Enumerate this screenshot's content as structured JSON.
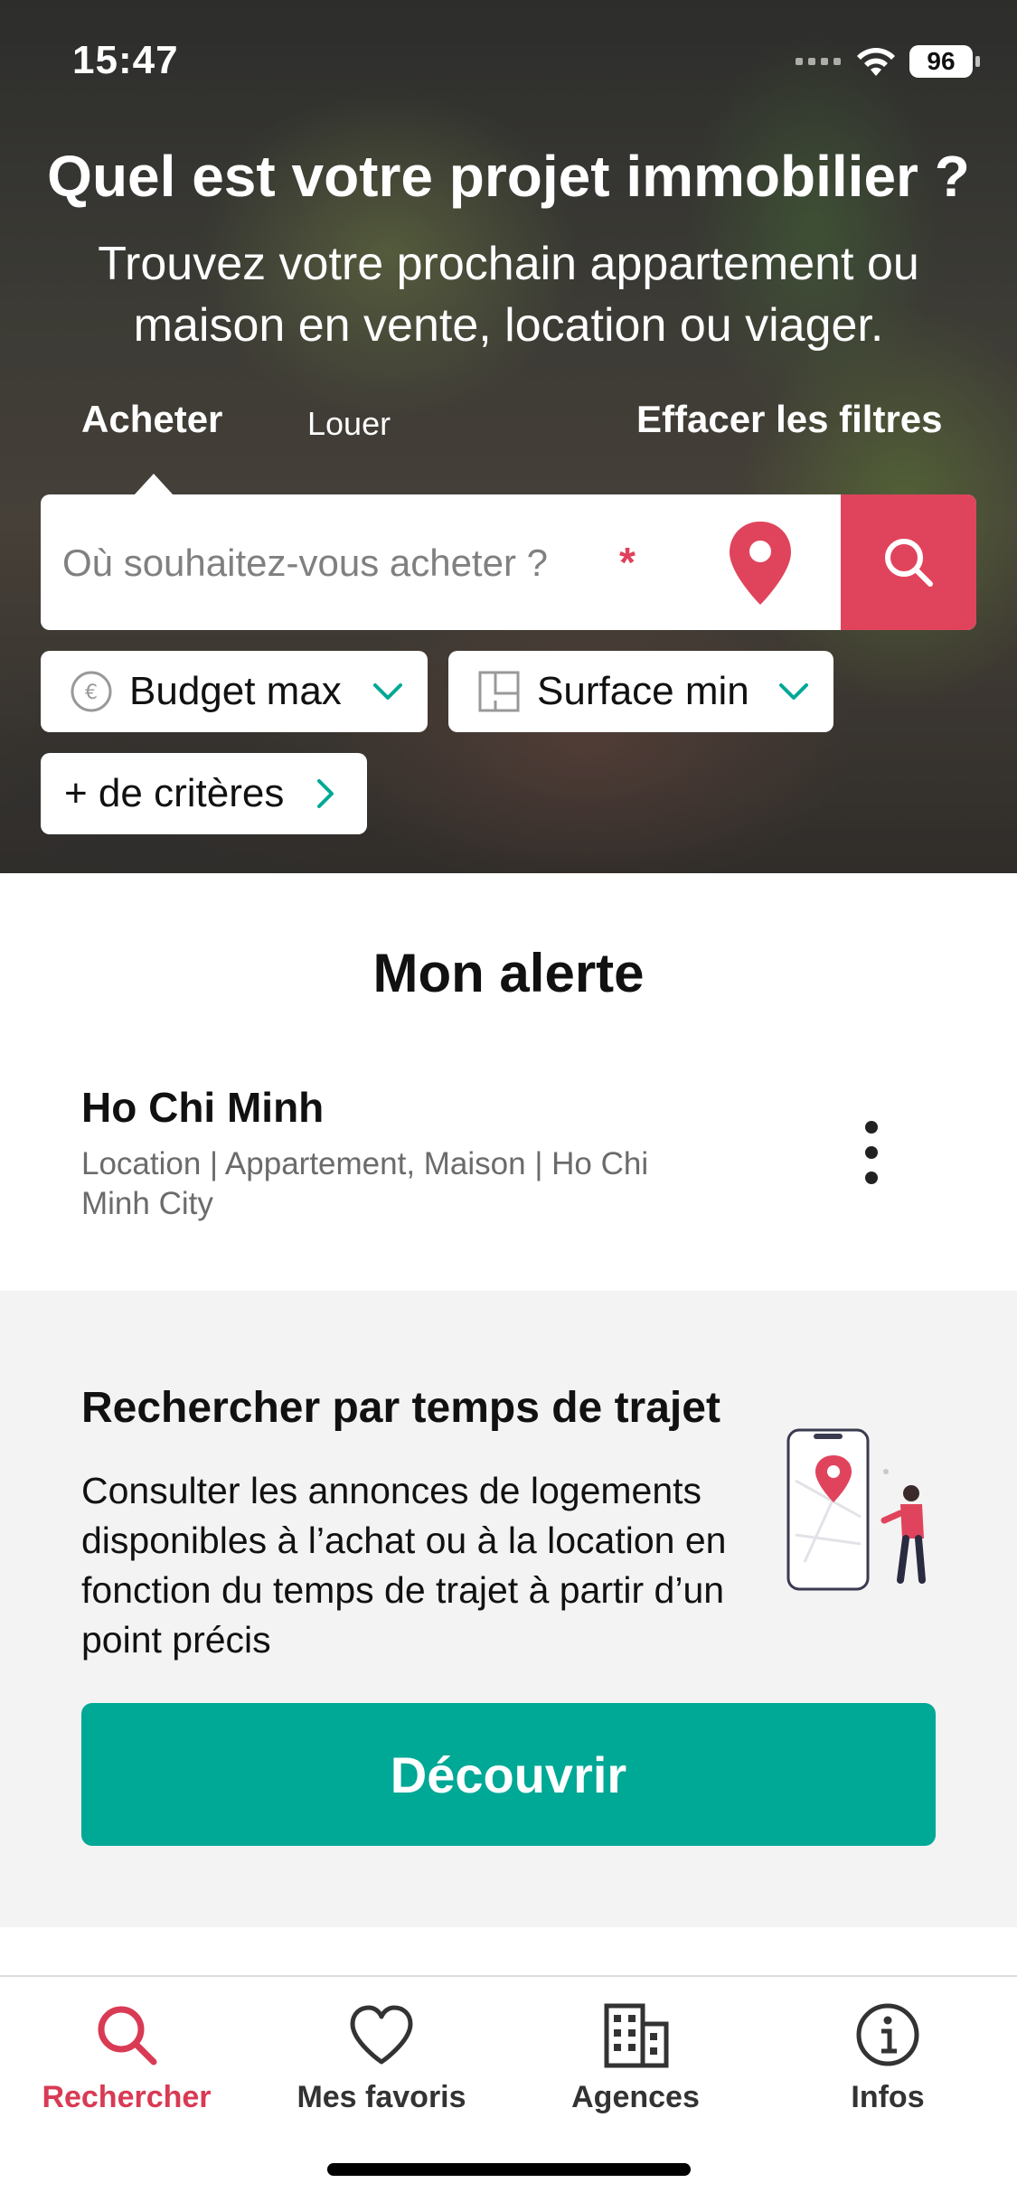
{
  "status_bar": {
    "time": "15:47",
    "battery": "96"
  },
  "hero": {
    "title": "Quel est votre projet immobilier ?",
    "subtitle": "Trouvez votre prochain appartement ou maison en vente, location ou viager.",
    "tabs": {
      "buy": "Acheter",
      "rent": "Louer",
      "clear_filters": "Effacer les filtres"
    },
    "search": {
      "placeholder": "Où souhaitez-vous acheter ?",
      "required_mark": "*"
    },
    "filters": {
      "budget": "Budget max",
      "surface": "Surface min",
      "more_criteria": "+ de critères"
    }
  },
  "alert": {
    "heading": "Mon alerte",
    "name": "Ho Chi Minh",
    "details": "Location | Appartement, Maison | Ho Chi Minh City"
  },
  "travel": {
    "title": "Rechercher par temps de trajet",
    "description": "Consulter les annonces de logements disponibles à l’achat ou à la location en fonction du temps de trajet à partir d’un point précis",
    "button": "Découvrir"
  },
  "tab_bar": {
    "search": "Rechercher",
    "favorites": "Mes favoris",
    "agencies": "Agences",
    "infos": "Infos",
    "active": "search"
  },
  "colors": {
    "accent_red": "#e0445c",
    "accent_teal": "#00a896"
  }
}
